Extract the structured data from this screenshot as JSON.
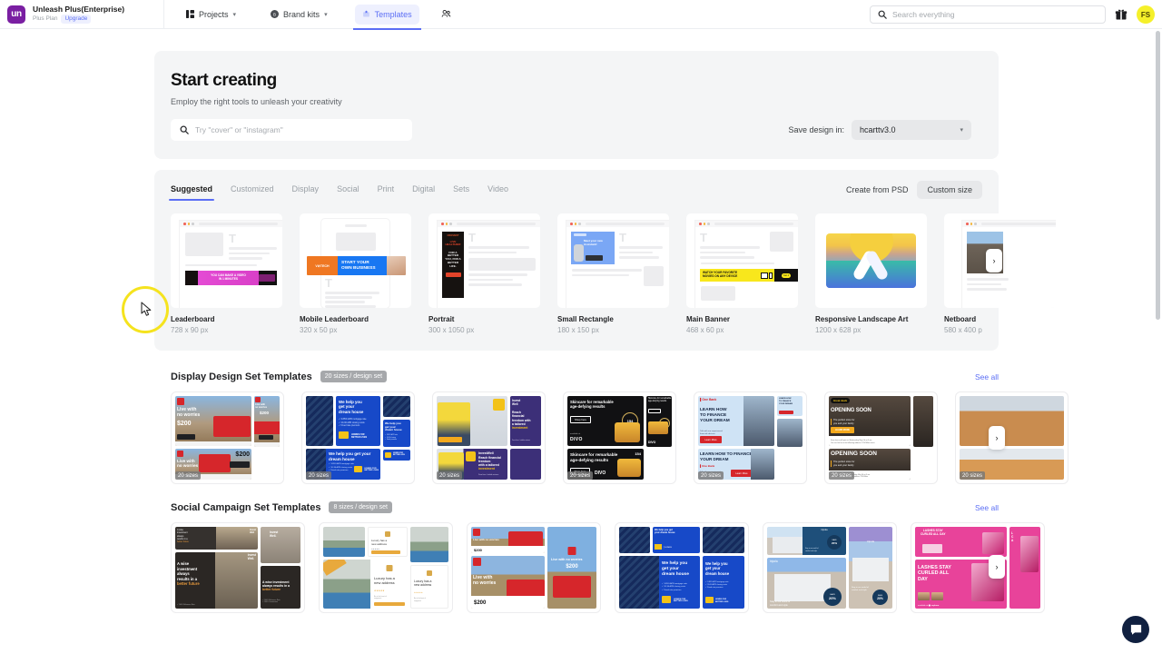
{
  "topnav": {
    "brand": {
      "name": "Unleash Plus(Enterprise)",
      "plan": "Plus Plan",
      "upgrade": "Upgrade",
      "logo_text": "un"
    },
    "items": [
      {
        "label": "Projects",
        "icon": "grid-icon",
        "has_caret": true,
        "active": false
      },
      {
        "label": "Brand kits",
        "icon": "palette-icon",
        "has_caret": true,
        "active": false
      },
      {
        "label": "Templates",
        "icon": "sparkle-icon",
        "has_caret": false,
        "active": true
      }
    ],
    "people_icon": "people-icon",
    "search": {
      "placeholder": "Search everything",
      "value": "",
      "icon": "search-icon"
    },
    "gift_icon": "gift-icon",
    "avatar": {
      "initials": "FS",
      "color": "#f5f02a"
    }
  },
  "hero": {
    "title": "Start creating",
    "subtitle": "Employ the right tools to unleash your creativity",
    "search": {
      "placeholder": "Try \"cover\" or \"instagram\"",
      "value": "",
      "icon": "search-icon"
    },
    "save_label": "Save design in:",
    "save_value": "hcarttv3.0",
    "save_caret": "chevron-down-icon"
  },
  "templates_panel": {
    "tabs": [
      {
        "label": "Suggested",
        "active": true
      },
      {
        "label": "Customized",
        "active": false
      },
      {
        "label": "Display",
        "active": false
      },
      {
        "label": "Social",
        "active": false
      },
      {
        "label": "Print",
        "active": false
      },
      {
        "label": "Digital",
        "active": false
      },
      {
        "label": "Sets",
        "active": false
      },
      {
        "label": "Video",
        "active": false
      }
    ],
    "create_from_psd": "Create from PSD",
    "custom_size": "Custom size",
    "next_arrow": "chevron-right-icon",
    "cards": [
      {
        "name": "Leaderboard",
        "dim": "728 x 90 px",
        "kind": "leaderboard"
      },
      {
        "name": "Mobile Leaderboard",
        "dim": "320 x 50 px",
        "kind": "mobile-leaderboard"
      },
      {
        "name": "Portrait",
        "dim": "300 x 1050 px",
        "kind": "portrait"
      },
      {
        "name": "Small Rectangle",
        "dim": "180 x 150 px",
        "kind": "small-rectangle"
      },
      {
        "name": "Main Banner",
        "dim": "468 x 60 px",
        "kind": "main-banner"
      },
      {
        "name": "Responsive Landscape Art",
        "dim": "1200 x 628 px",
        "kind": "responsive-art"
      },
      {
        "name": "Netboard",
        "dim": "580 x 400 p",
        "kind": "netboard"
      }
    ]
  },
  "display_section": {
    "title": "Display Design Set Templates",
    "badge": "20 sizes / design set",
    "see_all": "See all",
    "next_arrow": "chevron-right-icon",
    "size_badge": "20 sizes",
    "cards": [
      {
        "theme": "red-credit-card",
        "headline": "Live with no worries",
        "price": "$200",
        "cta": "Learn More"
      },
      {
        "theme": "blue-dream-house",
        "headline": "We help you get your dream house",
        "cta": "HOMES FOR BETTER LIVES"
      },
      {
        "theme": "invest-well-yellow",
        "headline": "Reach financial freedom with a tailored investment",
        "cta": "InvestWell"
      },
      {
        "theme": "divo-skincare",
        "headline": "Skincare for remarkable age-defying results",
        "price": "154",
        "cta": "Shop here"
      },
      {
        "theme": "one-bank-finance",
        "headline": "LEARN HOW TO FINANCE YOUR DREAM",
        "cta": "Learn More"
      },
      {
        "theme": "opening-soon",
        "headline": "OPENING SOON",
        "cta": "LEARN MORE"
      },
      {
        "theme": "building-orange",
        "headline": "",
        "cta": ""
      }
    ]
  },
  "social_section": {
    "title": "Social Campaign Set Templates",
    "badge": "8 sizes / design set",
    "see_all": "See all",
    "next_arrow": "chevron-right-icon",
    "cards": [
      {
        "theme": "invest-well-dark",
        "headline": "A wise investment always results in a better future"
      },
      {
        "theme": "luxury-address",
        "headline": "Luxury has a new address"
      },
      {
        "theme": "red-card-outdoor",
        "headline": "Live with no worries",
        "price": "$200"
      },
      {
        "theme": "blue-dream-house",
        "headline": "We help you get your dream house"
      },
      {
        "theme": "tripola-save",
        "headline": "Stay in our world of comfort and style",
        "price": "SAVE 20%"
      },
      {
        "theme": "pink-lashes",
        "headline": "LASHES STAY CURLED ALL DAY"
      }
    ]
  },
  "chat": {
    "icon": "chat-bubble-icon"
  },
  "cursor": {
    "icon": "mouse-cursor-icon",
    "highlight_color": "#f5e31e"
  }
}
